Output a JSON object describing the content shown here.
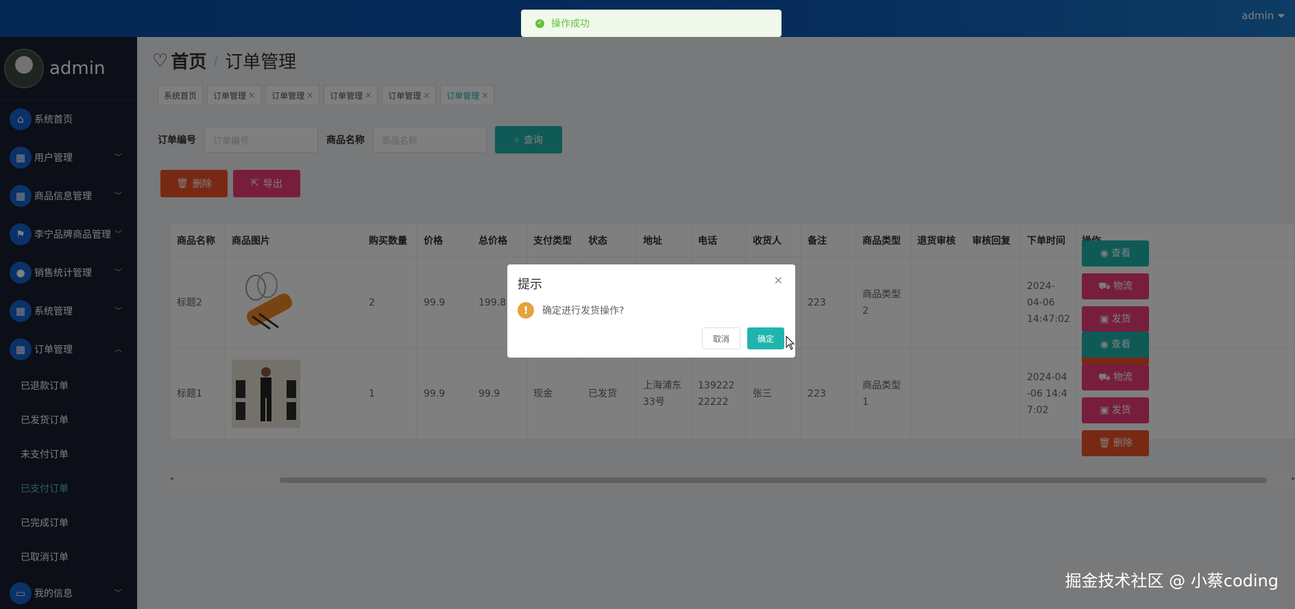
{
  "header": {
    "user": "admin ⏷"
  },
  "toast": {
    "text": "操作成功"
  },
  "sidebar": {
    "profile_name": "admin",
    "items": [
      {
        "label": "系统首页",
        "icon": "home-icon"
      },
      {
        "label": "用户管理",
        "icon": "grid-icon"
      },
      {
        "label": "商品信息管理",
        "icon": "grid-icon"
      },
      {
        "label": "李宁品牌商品管理",
        "icon": "flag-icon"
      },
      {
        "label": "销售统计管理",
        "icon": "bulb-icon"
      },
      {
        "label": "系统管理",
        "icon": "grid-icon"
      },
      {
        "label": "订单管理",
        "icon": "grid-icon"
      }
    ],
    "sub_items": [
      "已退款订单",
      "已发货订单",
      "未支付订单",
      "已支付订单",
      "已完成订单",
      "已取消订单"
    ],
    "last_item": {
      "label": "我的信息",
      "icon": "card-icon"
    }
  },
  "page": {
    "title_main": "首页",
    "title_sub": "订单管理",
    "tags": [
      "系统首页",
      "订单管理",
      "订单管理",
      "订单管理",
      "订单管理",
      "订单管理"
    ]
  },
  "search": {
    "order_no_label": "订单编号",
    "order_no_placeholder": "订单编号",
    "product_label": "商品名称",
    "product_placeholder": "商品名称",
    "query_label": "查询"
  },
  "toolbar": {
    "delete_label": "删除",
    "export_label": "导出"
  },
  "table": {
    "headers": [
      "商品名称",
      "商品图片",
      "购买数量",
      "价格",
      "总价格",
      "支付类型",
      "状态",
      "地址",
      "电话",
      "收货人",
      "备注",
      "商品类型",
      "退货审核",
      "审核回复",
      "下单时间",
      "操作"
    ],
    "rows": [
      [
        "标题2",
        "",
        "2",
        "99.9",
        "199.8",
        "",
        "",
        "",
        "",
        "",
        "223",
        "商品类型2",
        "",
        "",
        "2024-04-06 14:47:02",
        ""
      ],
      [
        "标题1",
        "",
        "1",
        "99.9",
        "99.9",
        "现金",
        "已发货",
        "上海浦东33号",
        "13922222222",
        "张三",
        "223",
        "商品类型1",
        "",
        "",
        "2024-04-06 14:47:02",
        ""
      ]
    ],
    "ops": {
      "view": "查看",
      "logistics": "物流",
      "ship": "发货",
      "delete": "删除"
    }
  },
  "dialog": {
    "title": "提示",
    "message": "确定进行发货操作?",
    "cancel": "取消",
    "confirm": "确定"
  },
  "watermark": "掘金技术社区 @ 小蔡coding"
}
